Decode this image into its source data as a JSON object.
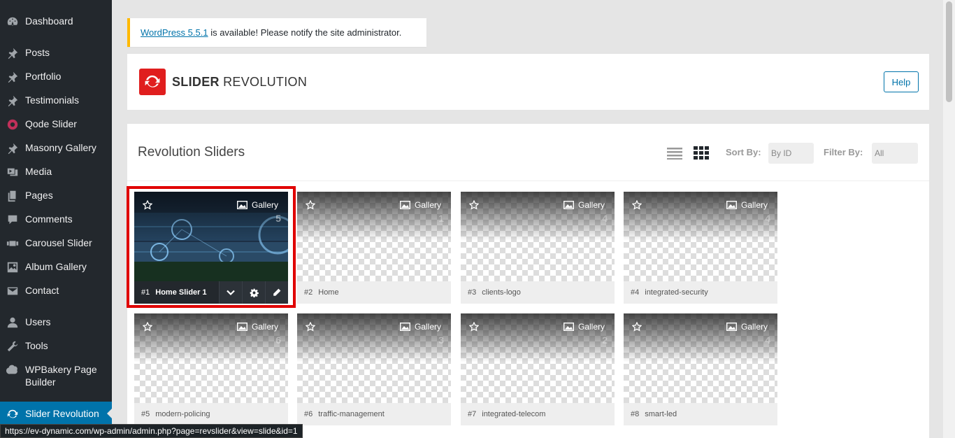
{
  "sidebar": {
    "items": [
      {
        "label": "Dashboard",
        "icon": "dashboard-icon"
      },
      {
        "label": "Posts",
        "icon": "pin-icon"
      },
      {
        "label": "Portfolio",
        "icon": "pin-icon"
      },
      {
        "label": "Testimonials",
        "icon": "pin-icon"
      },
      {
        "label": "Qode Slider",
        "icon": "ring-icon"
      },
      {
        "label": "Masonry Gallery",
        "icon": "pin-icon"
      },
      {
        "label": "Media",
        "icon": "media-icon"
      },
      {
        "label": "Pages",
        "icon": "pages-icon"
      },
      {
        "label": "Comments",
        "icon": "comment-icon"
      },
      {
        "label": "Carousel Slider",
        "icon": "carousel-icon"
      },
      {
        "label": "Album Gallery",
        "icon": "gallery-icon"
      },
      {
        "label": "Contact",
        "icon": "mail-icon"
      },
      {
        "label": "Users",
        "icon": "user-icon"
      },
      {
        "label": "Tools",
        "icon": "wrench-icon"
      },
      {
        "label": "WPBakery Page Builder",
        "icon": "wpbakery-icon"
      },
      {
        "label": "Slider Revolution",
        "icon": "refresh-icon"
      }
    ]
  },
  "notice": {
    "link": "WordPress 5.5.1",
    "text": " is available! Please notify the site administrator."
  },
  "header": {
    "logo_bold": "SLIDER",
    "logo_light": " REVOLUTION",
    "help": "Help"
  },
  "main": {
    "title": "Revolution Sliders",
    "sort_label": "Sort By:",
    "sort_value": "By ID",
    "filter_label": "Filter By:",
    "filter_value": "All"
  },
  "sliders": [
    {
      "id": "#1",
      "name": "Home Slider 1",
      "type": "Gallery",
      "count": "5"
    },
    {
      "id": "#2",
      "name": "Home",
      "type": "Gallery",
      "count": "1"
    },
    {
      "id": "#3",
      "name": "clients-logo",
      "type": "Gallery",
      "count": "4"
    },
    {
      "id": "#4",
      "name": "integrated-security",
      "type": "Gallery",
      "count": "4"
    },
    {
      "id": "#5",
      "name": "modern-policing",
      "type": "Gallery",
      "count": "6"
    },
    {
      "id": "#6",
      "name": "traffic-management",
      "type": "Gallery",
      "count": "3"
    },
    {
      "id": "#7",
      "name": "integrated-telecom",
      "type": "Gallery",
      "count": "2"
    },
    {
      "id": "#8",
      "name": "smart-led",
      "type": "Gallery",
      "count": "4"
    }
  ],
  "statusbar": {
    "url": "https://ev-dynamic.com/wp-admin/admin.php?page=revslider&view=slide&id=1"
  },
  "colors": {
    "sidebar_bg": "#23282d",
    "accent": "#0073aa",
    "notice_border": "#ffb900",
    "logo_red": "#e01e1e",
    "highlight": "#e00000"
  }
}
